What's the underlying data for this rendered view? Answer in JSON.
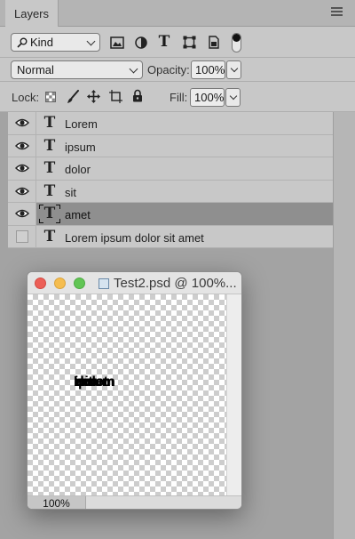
{
  "panel": {
    "tab_label": "Layers"
  },
  "filter": {
    "kind_label": "Kind"
  },
  "blend": {
    "mode": "Normal",
    "opacity_label": "Opacity:",
    "opacity_value": "100%"
  },
  "lock": {
    "label": "Lock:",
    "fill_label": "Fill:",
    "fill_value": "100%"
  },
  "layers": [
    {
      "name": "Lorem",
      "visible": true,
      "selected": false
    },
    {
      "name": "ipsum",
      "visible": true,
      "selected": false
    },
    {
      "name": "dolor",
      "visible": true,
      "selected": false
    },
    {
      "name": "sit",
      "visible": true,
      "selected": false
    },
    {
      "name": "amet",
      "visible": true,
      "selected": true
    },
    {
      "name": "Lorem ipsum dolor sit amet",
      "visible": false,
      "selected": false
    }
  ],
  "thumb_glyph": "T",
  "document": {
    "title": "Test2.psd @ 100%...",
    "zoom": "100%",
    "overlapping_text": [
      "Lorem",
      "ipsum",
      "dolor",
      "sit",
      "amet"
    ]
  },
  "colors": {
    "close": "#ec5f57",
    "minimize": "#f5bd4f",
    "zoom": "#61c554",
    "selected_row": "#8f8f8f"
  }
}
